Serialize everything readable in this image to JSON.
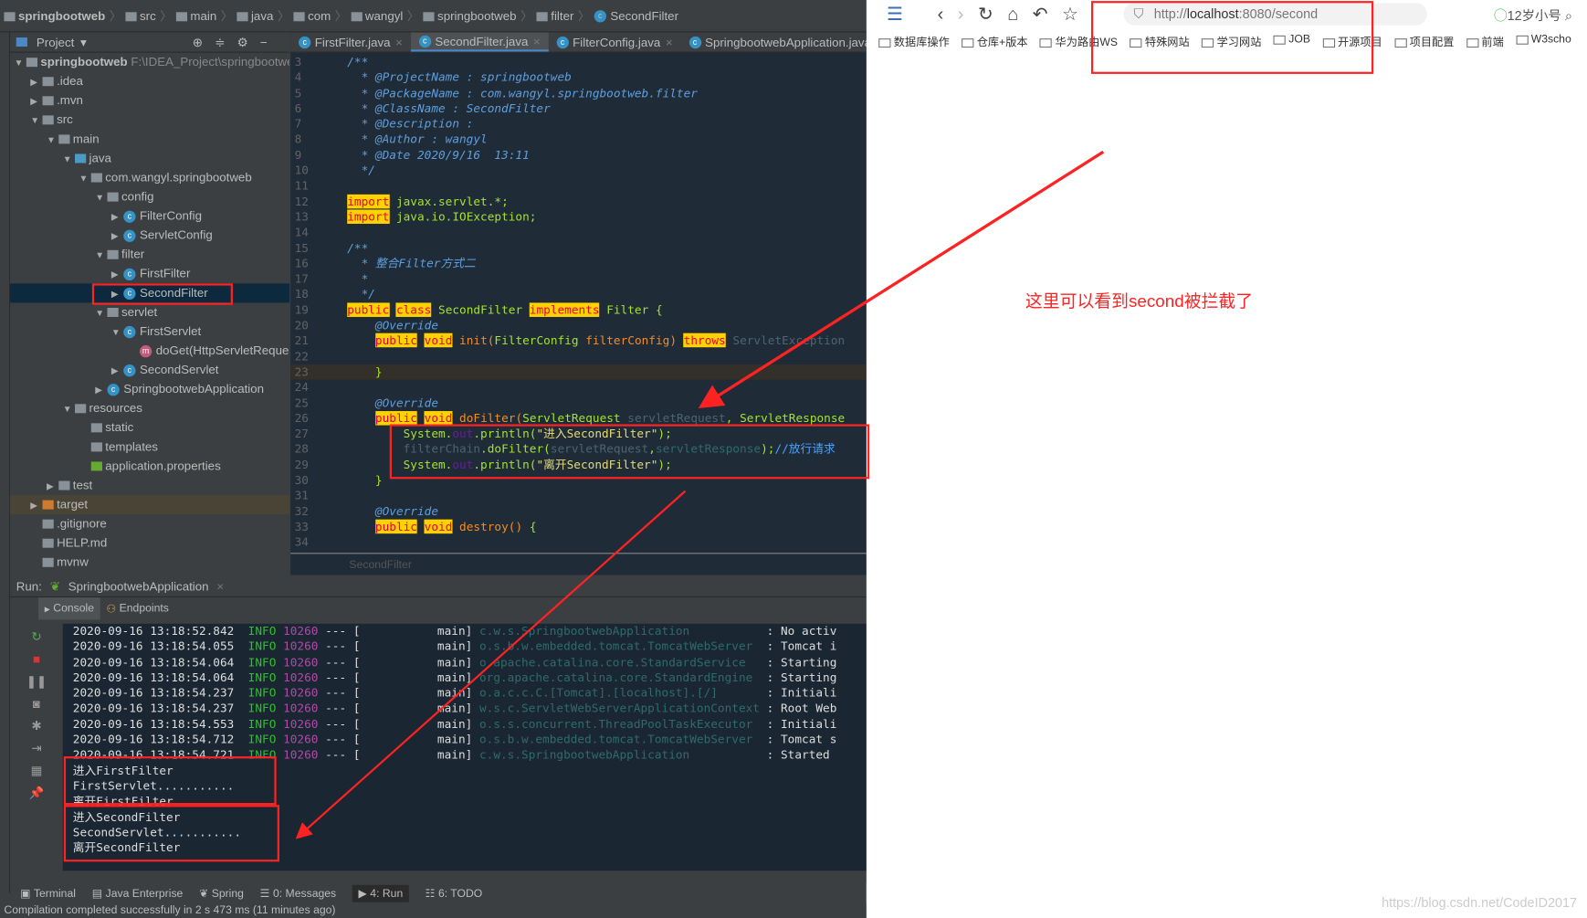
{
  "breadcrumb": [
    "springbootweb",
    "src",
    "main",
    "java",
    "com",
    "wangyl",
    "springbootweb",
    "filter",
    "SecondFilter"
  ],
  "project": {
    "title": "Project",
    "root": "springbootweb",
    "root_path": "F:\\IDEA_Project\\springbootweb",
    "tree": [
      {
        "label": ".idea",
        "depth": 1,
        "arrow": "right",
        "icon": "folder"
      },
      {
        "label": ".mvn",
        "depth": 1,
        "arrow": "right",
        "icon": "folder"
      },
      {
        "label": "src",
        "depth": 1,
        "arrow": "down",
        "icon": "folder"
      },
      {
        "label": "main",
        "depth": 2,
        "arrow": "down",
        "icon": "folder"
      },
      {
        "label": "java",
        "depth": 3,
        "arrow": "down",
        "icon": "source-folder"
      },
      {
        "label": "com.wangyl.springbootweb",
        "depth": 4,
        "arrow": "down",
        "icon": "package"
      },
      {
        "label": "config",
        "depth": 5,
        "arrow": "down",
        "icon": "package"
      },
      {
        "label": "FilterConfig",
        "depth": 6,
        "arrow": "right",
        "icon": "class"
      },
      {
        "label": "ServletConfig",
        "depth": 6,
        "arrow": "right",
        "icon": "class"
      },
      {
        "label": "filter",
        "depth": 5,
        "arrow": "down",
        "icon": "package"
      },
      {
        "label": "FirstFilter",
        "depth": 6,
        "arrow": "right",
        "icon": "class"
      },
      {
        "label": "SecondFilter",
        "depth": 6,
        "arrow": "right",
        "icon": "class",
        "selected": true
      },
      {
        "label": "servlet",
        "depth": 5,
        "arrow": "down",
        "icon": "package"
      },
      {
        "label": "FirstServlet",
        "depth": 6,
        "arrow": "down",
        "icon": "class"
      },
      {
        "label": "doGet(HttpServletRequest",
        "depth": 7,
        "arrow": "",
        "icon": "method"
      },
      {
        "label": "SecondServlet",
        "depth": 6,
        "arrow": "right",
        "icon": "class"
      },
      {
        "label": "SpringbootwebApplication",
        "depth": 5,
        "arrow": "right",
        "icon": "spring-class"
      },
      {
        "label": "resources",
        "depth": 3,
        "arrow": "down",
        "icon": "resources-folder"
      },
      {
        "label": "static",
        "depth": 4,
        "arrow": "",
        "icon": "folder"
      },
      {
        "label": "templates",
        "depth": 4,
        "arrow": "",
        "icon": "folder"
      },
      {
        "label": "application.properties",
        "depth": 4,
        "arrow": "",
        "icon": "spring-properties"
      },
      {
        "label": "test",
        "depth": 2,
        "arrow": "right",
        "icon": "folder"
      },
      {
        "label": "target",
        "depth": 1,
        "arrow": "right",
        "icon": "orange-folder"
      },
      {
        "label": ".gitignore",
        "depth": 1,
        "arrow": "",
        "icon": "file"
      },
      {
        "label": "HELP.md",
        "depth": 1,
        "arrow": "",
        "icon": "markdown-file"
      },
      {
        "label": "mvnw",
        "depth": 1,
        "arrow": "",
        "icon": "file"
      }
    ]
  },
  "editor": {
    "tabs": [
      {
        "label": "FirstFilter.java"
      },
      {
        "label": "SecondFilter.java",
        "active": true
      },
      {
        "label": "FilterConfig.java"
      },
      {
        "label": "SpringbootwebApplication.java"
      }
    ],
    "footer": "SecondFilter",
    "lines": [
      {
        "n": "3",
        "t": [
          [
            "doc",
            "/**"
          ]
        ]
      },
      {
        "n": "4",
        "t": [
          [
            "doc",
            "  * @ProjectName : springbootweb"
          ]
        ]
      },
      {
        "n": "5",
        "t": [
          [
            "doc",
            "  * @PackageName : com.wangyl.springbootweb.filter"
          ]
        ]
      },
      {
        "n": "6",
        "t": [
          [
            "doc",
            "  * @ClassName : SecondFilter"
          ]
        ]
      },
      {
        "n": "7",
        "t": [
          [
            "doc",
            "  * @Description :"
          ]
        ]
      },
      {
        "n": "8",
        "t": [
          [
            "doc",
            "  * @Author : wangyl"
          ]
        ]
      },
      {
        "n": "9",
        "t": [
          [
            "doc",
            "  * @Date 2020/9/16  13:11"
          ]
        ]
      },
      {
        "n": "10",
        "t": [
          [
            "doc",
            "  */"
          ]
        ]
      },
      {
        "n": "11",
        "t": []
      },
      {
        "n": "12",
        "t": [
          [
            "kw",
            "import"
          ],
          [
            "id",
            " javax.servlet.*;"
          ]
        ]
      },
      {
        "n": "13",
        "t": [
          [
            "kw",
            "import"
          ],
          [
            "id",
            " java.io.IOException;"
          ]
        ]
      },
      {
        "n": "14",
        "t": []
      },
      {
        "n": "15",
        "t": [
          [
            "doc",
            "/**"
          ]
        ]
      },
      {
        "n": "16",
        "t": [
          [
            "doc",
            "  * 整合Filter方式二"
          ]
        ]
      },
      {
        "n": "17",
        "t": [
          [
            "doc",
            "  *"
          ]
        ]
      },
      {
        "n": "18",
        "t": [
          [
            "doc",
            "  */"
          ]
        ]
      },
      {
        "n": "19",
        "t": [
          [
            "kw",
            "public"
          ],
          [
            "plain",
            " "
          ],
          [
            "kw",
            "class"
          ],
          [
            "id",
            " SecondFilter "
          ],
          [
            "kw",
            "implements"
          ],
          [
            "id",
            " Filter {"
          ]
        ]
      },
      {
        "n": "20",
        "t": [
          [
            "ann",
            "    @Override"
          ]
        ]
      },
      {
        "n": "21",
        "t": [
          [
            "plain",
            "    "
          ],
          [
            "kw",
            "public"
          ],
          [
            "plain",
            " "
          ],
          [
            "kw",
            "void"
          ],
          [
            "p",
            " init("
          ],
          [
            "id",
            "FilterConfig"
          ],
          [
            "p",
            " filterConfig) "
          ],
          [
            "kw",
            "throws"
          ],
          [
            "dim",
            " ServletException"
          ]
        ]
      },
      {
        "n": "22",
        "t": []
      },
      {
        "n": "23",
        "t": [
          [
            "id",
            "    }"
          ]
        ],
        "hl": true
      },
      {
        "n": "24",
        "t": []
      },
      {
        "n": "25",
        "t": [
          [
            "ann",
            "    @Override"
          ]
        ]
      },
      {
        "n": "26",
        "t": [
          [
            "plain",
            "    "
          ],
          [
            "kw",
            "public"
          ],
          [
            "plain",
            " "
          ],
          [
            "kw",
            "void"
          ],
          [
            "p",
            " doFilter("
          ],
          [
            "id",
            "ServletRequest"
          ],
          [
            "dim",
            " servletRequest"
          ],
          [
            "id",
            ", ServletResponse"
          ]
        ]
      },
      {
        "n": "27",
        "t": [
          [
            "id",
            "        System."
          ],
          [
            "out",
            "out"
          ],
          [
            "id",
            ".println("
          ],
          [
            "str",
            "\"进入SecondFilter\""
          ],
          [
            "id",
            ");"
          ]
        ]
      },
      {
        "n": "28",
        "t": [
          [
            "dim",
            "        filterChain"
          ],
          [
            "id",
            ".doFilter("
          ],
          [
            "dim",
            "servletRequest"
          ],
          [
            "id",
            ","
          ],
          [
            "lg",
            "servletResponse"
          ],
          [
            "id",
            ");"
          ],
          [
            "cm",
            "//放行请求"
          ]
        ]
      },
      {
        "n": "29",
        "t": [
          [
            "id",
            "        System."
          ],
          [
            "out",
            "out"
          ],
          [
            "id",
            ".println("
          ],
          [
            "str",
            "\"离开SecondFilter\""
          ],
          [
            "id",
            ");"
          ]
        ]
      },
      {
        "n": "30",
        "t": [
          [
            "id",
            "    }"
          ]
        ]
      },
      {
        "n": "31",
        "t": []
      },
      {
        "n": "32",
        "t": [
          [
            "ann",
            "    @Override"
          ]
        ]
      },
      {
        "n": "33",
        "t": [
          [
            "plain",
            "    "
          ],
          [
            "kw",
            "public"
          ],
          [
            "plain",
            " "
          ],
          [
            "kw",
            "void"
          ],
          [
            "p",
            " destroy() "
          ],
          [
            "id",
            "{"
          ]
        ]
      },
      {
        "n": "34",
        "t": []
      }
    ]
  },
  "run": {
    "label": "Run:",
    "config": "SpringbootwebApplication",
    "tabs": [
      "Console",
      "Endpoints"
    ],
    "logs": [
      {
        "time": "2020-09-16 13:18:52.842",
        "level": "INFO",
        "pid": "10260",
        "logger": "c.w.s.SpringbootwebApplication",
        "msg": ": No activ"
      },
      {
        "time": "2020-09-16 13:18:54.055",
        "level": "INFO",
        "pid": "10260",
        "logger": "o.s.b.w.embedded.tomcat.TomcatWebServer",
        "msg": ": Tomcat i"
      },
      {
        "time": "2020-09-16 13:18:54.064",
        "level": "INFO",
        "pid": "10260",
        "logger": "o.apache.catalina.core.StandardService",
        "msg": ": Starting"
      },
      {
        "time": "2020-09-16 13:18:54.064",
        "level": "INFO",
        "pid": "10260",
        "logger": "org.apache.catalina.core.StandardEngine",
        "msg": ": Starting"
      },
      {
        "time": "2020-09-16 13:18:54.237",
        "level": "INFO",
        "pid": "10260",
        "logger": "o.a.c.c.C.[Tomcat].[localhost].[/]",
        "msg": ": Initiali"
      },
      {
        "time": "2020-09-16 13:18:54.237",
        "level": "INFO",
        "pid": "10260",
        "logger": "w.s.c.ServletWebServerApplicationContext",
        "msg": ": Root Web"
      },
      {
        "time": "2020-09-16 13:18:54.553",
        "level": "INFO",
        "pid": "10260",
        "logger": "o.s.s.concurrent.ThreadPoolTaskExecutor",
        "msg": ": Initiali"
      },
      {
        "time": "2020-09-16 13:18:54.712",
        "level": "INFO",
        "pid": "10260",
        "logger": "o.s.b.w.embedded.tomcat.TomcatWebServer",
        "msg": ": Tomcat s"
      },
      {
        "time": "2020-09-16 13:18:54.721",
        "level": "INFO",
        "pid": "10260",
        "logger": "c.w.s.SpringbootwebApplication",
        "msg": ": Started"
      }
    ],
    "output": [
      "进入FirstFilter",
      "FirstServlet...........",
      "离开FirstFilter",
      "进入SecondFilter",
      "SecondServlet...........",
      "离开SecondFilter"
    ]
  },
  "bottom_tabs": [
    "Terminal",
    "Java Enterprise",
    "Spring",
    "0: Messages",
    "4: Run",
    "6: TODO"
  ],
  "status": "Compilation completed successfully in 2 s 473 ms (11 minutes ago)",
  "browser": {
    "url_prefix": "http://",
    "url_host": "localhost",
    "url_rest": ":8080/second",
    "search": "12岁小号",
    "bookmarks": [
      "数据库操作",
      "仓库+版本",
      "华为路由WS",
      "特殊网站",
      "学习网站",
      "JOB",
      "开源项目",
      "项目配置",
      "前端",
      "W3scho"
    ]
  },
  "annotation": "这里可以看到second被拦截了",
  "watermark": "https://blog.csdn.net/CodeID2017",
  "colors": {
    "annotation": "#ff2222",
    "keyword_bg": "#ffd200"
  }
}
